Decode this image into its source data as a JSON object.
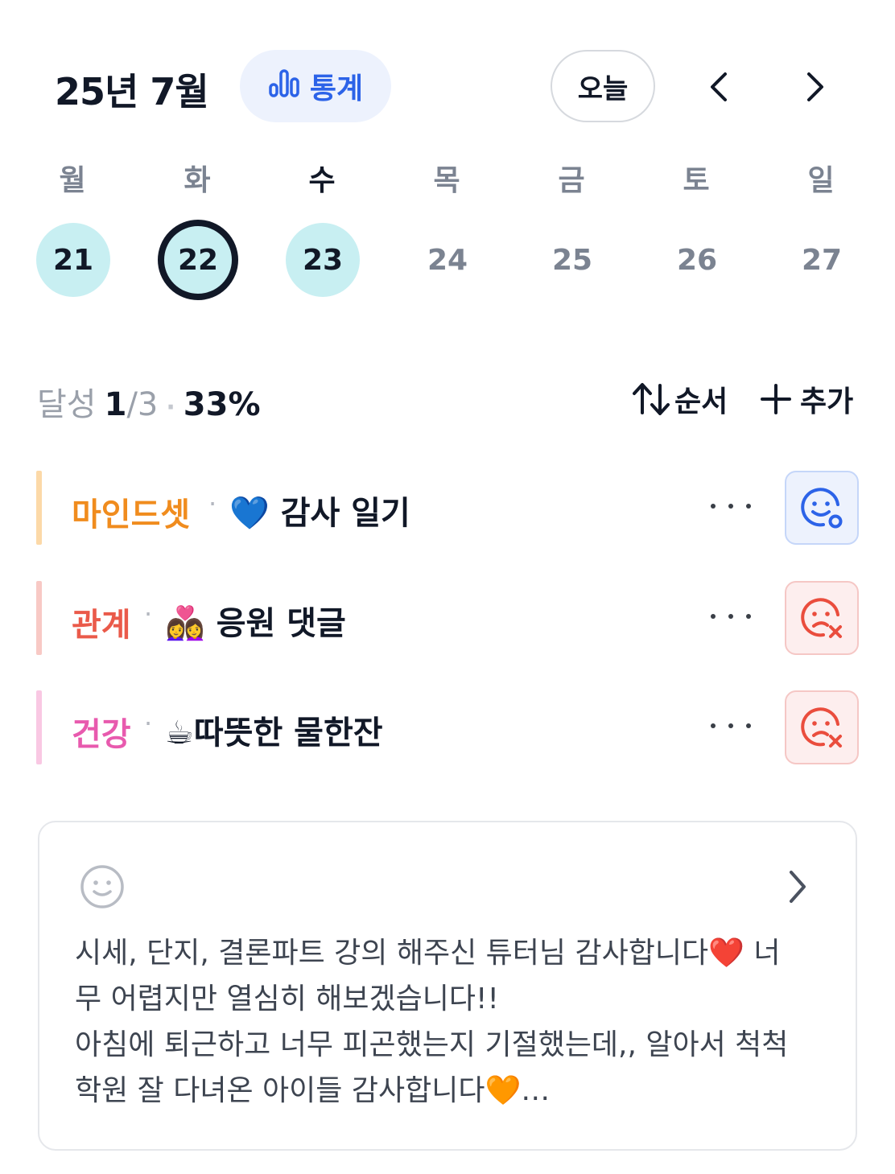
{
  "header": {
    "month_title": "25년 7월",
    "stats_label": "통계",
    "today_label": "오늘"
  },
  "week": {
    "weekdays": [
      "월",
      "화",
      "수",
      "목",
      "금",
      "토",
      "일"
    ],
    "days": [
      "21",
      "22",
      "23",
      "24",
      "25",
      "26",
      "27"
    ],
    "today_index": 2,
    "selected_index": 1
  },
  "summary": {
    "label": "달성",
    "done": "1",
    "total": "/3",
    "separator": "·",
    "percent": "33%",
    "order_label": "순서",
    "add_label": "추가"
  },
  "habits": [
    {
      "category": "마인드셋",
      "separator": "·",
      "title": "💙 감사 일기",
      "status": "done",
      "accent": "#fcd9a8",
      "category_color": "#f08c1e"
    },
    {
      "category": "관계",
      "separator": "·",
      "title": "👩‍❤️‍👩 응원 댓글",
      "status": "missed",
      "accent": "#f8c9c5",
      "category_color": "#ea5a4a"
    },
    {
      "category": "건강",
      "separator": "·",
      "title": "☕따뜻한 물한잔",
      "status": "missed",
      "accent": "#f9c8e3",
      "category_color": "#e85aae"
    }
  ],
  "note": {
    "lines": [
      "시세, 단지, 결론파트 강의 해주신 튜터님 감사합니다❤️ 너",
      "무 어렵지만 열심히 해보겠습니다!!",
      "아침에 퇴근하고 너무 피곤했는지 기절했는데,, 알아서 척척",
      "학원 잘 다녀온 아이들 감사합니다🧡…"
    ]
  },
  "colors": {
    "accent_blue": "#2c63e8",
    "done_day_bg": "#c8eff2",
    "missed_red": "#ea4d3d"
  }
}
